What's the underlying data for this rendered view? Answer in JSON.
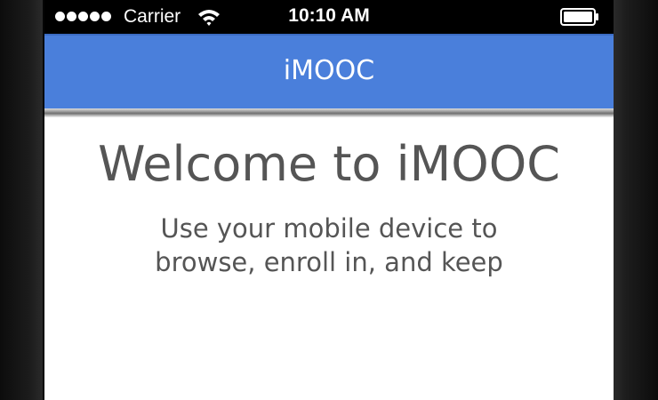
{
  "status_bar": {
    "carrier": "Carrier",
    "time": "10:10 AM",
    "signal_bars": 5
  },
  "nav_bar": {
    "title": "iMOOC",
    "color": "#4a7fdb"
  },
  "content": {
    "welcome_title": "Welcome to iMOOC",
    "intro_text": "Use your mobile device to browse, enroll in, and keep"
  },
  "icons": {
    "signal": "signal-dots-icon",
    "wifi": "wifi-icon",
    "battery": "battery-icon"
  }
}
